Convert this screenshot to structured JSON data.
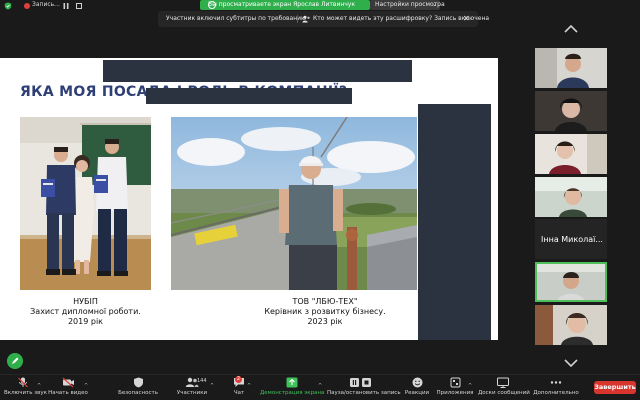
{
  "topbar": {
    "recording_label": "Запись...",
    "view_banner": "Вы просматриваете экран Ярослав Литвинчук",
    "view_options": "Настройки просмотра"
  },
  "notification": {
    "subtitles_text": "Участник включил субтитры по требованию",
    "transcript_text": "Кто может видеть эту расшифровку? Запись включена"
  },
  "slide": {
    "title": "ЯКА МОЯ ПОСАДА І РОЛЬ В КОМПАНІЇ?",
    "left_caption": [
      "НУБІП",
      "Захист дипломної роботи.",
      "2019 рік"
    ],
    "right_caption": [
      "ТОВ \"ЛБЮ-ТЕХ\"",
      "Керівник з розвитку бізнесу.",
      "2023 рік"
    ]
  },
  "participants": {
    "named_tile": "Інна Миколаї..."
  },
  "toolbar": {
    "items": [
      {
        "label": "Включить звук"
      },
      {
        "label": "Начать видео"
      },
      {
        "label": "Безопасность"
      },
      {
        "label": "Участники",
        "count": "144"
      },
      {
        "label": "Чат",
        "badge": "2"
      },
      {
        "label": "Демонстрация экрана"
      },
      {
        "label": "Пауза/остановить запись"
      },
      {
        "label": "Реакции"
      },
      {
        "label": "Приложения"
      },
      {
        "label": "Доски сообщений"
      },
      {
        "label": "Дополнительно"
      }
    ],
    "end_label": "Завершить"
  },
  "colors": {
    "zoom_green": "#2fae4c",
    "end_red": "#d8352f",
    "slide_title_blue": "#2d3f74",
    "redaction": "#2b3240"
  }
}
